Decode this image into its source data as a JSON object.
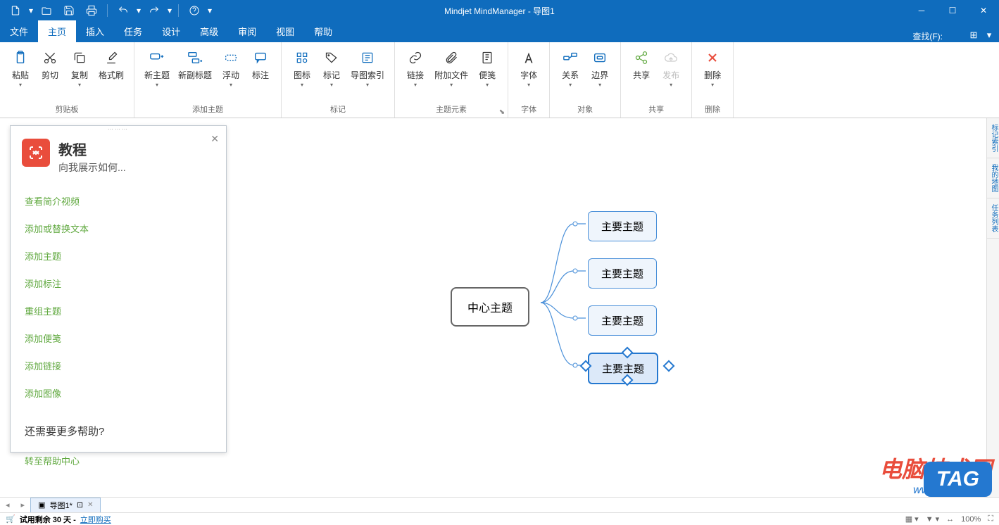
{
  "app": {
    "title": "Mindjet MindManager - 导图1"
  },
  "qat": {
    "items": [
      "new",
      "open",
      "save",
      "print",
      "undo",
      "redo",
      "help"
    ]
  },
  "menu": {
    "tabs": [
      "文件",
      "主页",
      "插入",
      "任务",
      "设计",
      "高级",
      "审阅",
      "视图",
      "帮助"
    ],
    "active": 1,
    "search_label": "查找(F):"
  },
  "ribbon": {
    "groups": [
      {
        "name": "clipboard",
        "label": "剪贴板",
        "buttons": [
          {
            "label": "粘贴",
            "icon": "paste",
            "dd": true
          },
          {
            "label": "剪切",
            "icon": "cut"
          },
          {
            "label": "复制",
            "icon": "copy",
            "dd": true
          },
          {
            "label": "格式刷",
            "icon": "format-painter"
          }
        ]
      },
      {
        "name": "add-topic",
        "label": "添加主题",
        "buttons": [
          {
            "label": "新主题",
            "icon": "new-topic",
            "dd": true
          },
          {
            "label": "新副标题",
            "icon": "new-sub"
          },
          {
            "label": "浮动",
            "icon": "float",
            "dd": true
          },
          {
            "label": "标注",
            "icon": "callout"
          }
        ]
      },
      {
        "name": "markers",
        "label": "标记",
        "buttons": [
          {
            "label": "图标",
            "icon": "icon-marker",
            "dd": true
          },
          {
            "label": "标记",
            "icon": "tag",
            "dd": true
          },
          {
            "label": "导图索引",
            "icon": "index",
            "dd": true
          }
        ]
      },
      {
        "name": "elements",
        "label": "主题元素",
        "launcher": true,
        "buttons": [
          {
            "label": "链接",
            "icon": "link",
            "dd": true
          },
          {
            "label": "附加文件",
            "icon": "attach",
            "dd": true
          },
          {
            "label": "便笺",
            "icon": "note",
            "dd": true
          }
        ]
      },
      {
        "name": "font",
        "label": "字体",
        "buttons": [
          {
            "label": "字体",
            "icon": "font",
            "dd": true
          }
        ]
      },
      {
        "name": "object",
        "label": "对象",
        "buttons": [
          {
            "label": "关系",
            "icon": "relation",
            "dd": true
          },
          {
            "label": "边界",
            "icon": "boundary",
            "dd": true
          }
        ]
      },
      {
        "name": "share",
        "label": "共享",
        "buttons": [
          {
            "label": "共享",
            "icon": "share"
          },
          {
            "label": "发布",
            "icon": "publish",
            "disabled": true,
            "dd": true
          }
        ]
      },
      {
        "name": "delete",
        "label": "删除",
        "buttons": [
          {
            "label": "删除",
            "icon": "delete",
            "dd": true
          }
        ]
      }
    ]
  },
  "tutorial": {
    "title": "教程",
    "subtitle": "向我展示如何...",
    "links": [
      "查看简介视频",
      "添加或替换文本",
      "添加主题",
      "添加标注",
      "重组主题",
      "添加便笺",
      "添加链接",
      "添加图像"
    ],
    "more_label": "还需要更多帮助?",
    "help_link": "转至帮助中心"
  },
  "mindmap": {
    "central": "中心主题",
    "subs": [
      "主要主题",
      "主要主题",
      "主要主题",
      "主要主题"
    ],
    "selected_index": 3
  },
  "side_tabs": [
    "标记索引",
    "我的地图",
    "任务列表"
  ],
  "doctab": {
    "name": "导图1*"
  },
  "status": {
    "trial_text": "试用剩余 30 天 - ",
    "buy_text": "立即购买",
    "zoom": "100%"
  },
  "watermark": {
    "main": "电脑技术网",
    "url": "www.tagxp.com",
    "tag": "TAG"
  }
}
